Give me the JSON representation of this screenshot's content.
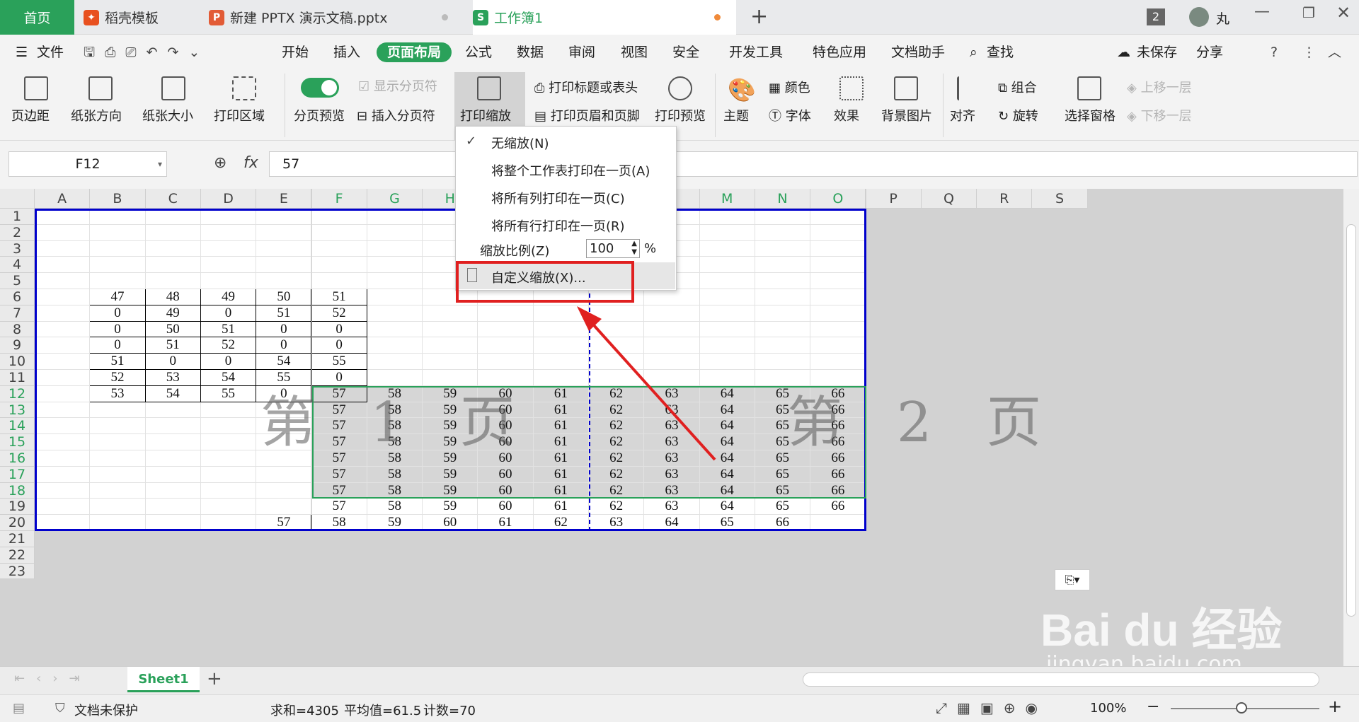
{
  "tabs": {
    "home": "首页",
    "t1": "稻壳模板",
    "t2": "新建 PPTX 演示文稿.pptx",
    "t3": "工作簿1",
    "count": "2",
    "user": "丸"
  },
  "menu": {
    "file": "文件",
    "items": [
      "开始",
      "插入",
      "页面布局",
      "公式",
      "数据",
      "审阅",
      "视图",
      "安全",
      "开发工具",
      "特色应用",
      "文档助手"
    ],
    "search": "查找",
    "unsaved": "未保存",
    "share": "分享"
  },
  "ribbon": {
    "margins": "页边距",
    "orientation": "纸张方向",
    "size": "纸张大小",
    "print_area": "打印区域",
    "page_preview": "分页预览",
    "show_breaks": "显示分页符",
    "insert_break": "插入分页符",
    "print_scale": "打印缩放",
    "print_titles": "打印标题或表头",
    "header_footer": "打印页眉和页脚",
    "print_preview": "打印预览",
    "theme": "主题",
    "colors": "颜色",
    "fonts": "字体",
    "effects": "效果",
    "bg_image": "背景图片",
    "align": "对齐",
    "group": "组合",
    "rotate": "旋转",
    "select_pane": "选择窗格",
    "bring_forward": "上移一层",
    "send_backward": "下移一层"
  },
  "formula": {
    "name_box": "F12",
    "fx": "fx",
    "value": "57"
  },
  "columns": [
    "A",
    "B",
    "C",
    "D",
    "E",
    "F",
    "G",
    "H",
    "I",
    "J",
    "K",
    "L",
    "M",
    "N",
    "O",
    "P",
    "Q",
    "R",
    "S"
  ],
  "rows": [
    "1",
    "2",
    "3",
    "4",
    "5",
    "6",
    "7",
    "8",
    "9",
    "10",
    "11",
    "12",
    "13",
    "14",
    "15",
    "16",
    "17",
    "18",
    "19",
    "20",
    "21",
    "22",
    "23"
  ],
  "cells": {
    "6": [
      "",
      "47",
      "48",
      "49",
      "50",
      "51"
    ],
    "7": [
      "",
      "0",
      "49",
      "0",
      "51",
      "52"
    ],
    "8": [
      "",
      "0",
      "50",
      "51",
      "0",
      "0"
    ],
    "9": [
      "",
      "0",
      "51",
      "52",
      "0",
      "0"
    ],
    "10": [
      "",
      "51",
      "0",
      "0",
      "54",
      "55"
    ],
    "11": [
      "",
      "52",
      "53",
      "54",
      "55",
      "0"
    ],
    "12": [
      "",
      "53",
      "54",
      "55",
      "0",
      "57",
      "58",
      "59",
      "60",
      "61",
      "62",
      "63",
      "64",
      "65",
      "66"
    ],
    "13": [
      "",
      "",
      "",
      "",
      "",
      "57",
      "58",
      "59",
      "60",
      "61",
      "62",
      "63",
      "64",
      "65",
      "66"
    ],
    "14": [
      "",
      "",
      "",
      "",
      "",
      "57",
      "58",
      "59",
      "60",
      "61",
      "62",
      "63",
      "64",
      "65",
      "66"
    ],
    "15": [
      "",
      "",
      "",
      "",
      "",
      "57",
      "58",
      "59",
      "60",
      "61",
      "62",
      "63",
      "64",
      "65",
      "66"
    ],
    "16": [
      "",
      "",
      "",
      "",
      "",
      "57",
      "58",
      "59",
      "60",
      "61",
      "62",
      "63",
      "64",
      "65",
      "66"
    ],
    "17": [
      "",
      "",
      "",
      "",
      "",
      "57",
      "58",
      "59",
      "60",
      "61",
      "62",
      "63",
      "64",
      "65",
      "66"
    ],
    "18": [
      "",
      "",
      "",
      "",
      "",
      "57",
      "58",
      "59",
      "60",
      "61",
      "62",
      "63",
      "64",
      "65",
      "66"
    ],
    "19": [
      "",
      "",
      "",
      "",
      "",
      "57",
      "58",
      "59",
      "60",
      "61",
      "62",
      "63",
      "64",
      "65",
      "66"
    ],
    "20": [
      "",
      "",
      "",
      "",
      "57",
      "58",
      "59",
      "60",
      "61",
      "62",
      "63",
      "64",
      "65",
      "66",
      ""
    ]
  },
  "watermarks": {
    "page1": "第 1 页",
    "page2": "第 2 页"
  },
  "dropdown": {
    "no_scale": "无缩放(N)",
    "fit_sheet": "将整个工作表打印在一页(A)",
    "fit_cols": "将所有列打印在一页(C)",
    "fit_rows": "将所有行打印在一页(R)",
    "ratio_label": "缩放比例(Z)",
    "ratio_value": "100",
    "percent": "%",
    "custom": "自定义缩放(X)..."
  },
  "sheet": {
    "tab": "Sheet1",
    "add": "+"
  },
  "status": {
    "protect": "文档未保护",
    "sum": "求和=4305",
    "avg": "平均值=61.5",
    "count": "计数=70",
    "zoom": "100%"
  },
  "brand": {
    "logo": "Bai du 经验",
    "url": "jingyan.baidu.com"
  },
  "colors": {
    "accent": "#2aa15a",
    "pagebreak": "#0000cc",
    "highlight": "#e02020"
  }
}
